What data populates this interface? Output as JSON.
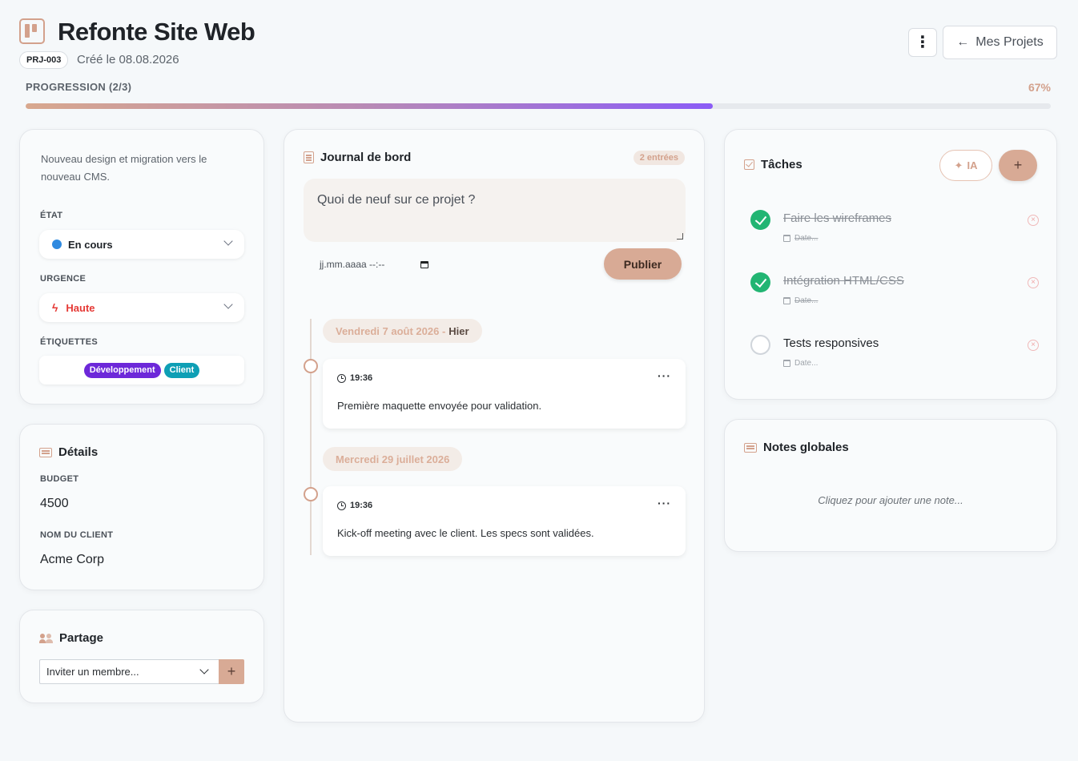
{
  "project": {
    "title": "Refonte Site Web",
    "code": "PRJ-003",
    "created": "Créé le 08.08.2026",
    "back_label": "Mes Projets"
  },
  "progress": {
    "label": "PROGRESSION (2/3)",
    "percent_label": "67%",
    "value": 0.67
  },
  "info": {
    "description": "Nouveau design et migration vers le nouveau CMS.",
    "state_label": "ÉTAT",
    "state_value": "En cours",
    "urgency_label": "URGENCE",
    "urgency_value": "Haute",
    "tags_label": "ÉTIQUETTES",
    "tags": [
      {
        "label": "Développement",
        "color": "#6d28d9"
      },
      {
        "label": "Client",
        "color": "#0e9fb5"
      }
    ]
  },
  "details": {
    "title": "Détails",
    "budget_label": "BUDGET",
    "budget_value": "4500",
    "client_label": "NOM DU CLIENT",
    "client_value": "Acme Corp"
  },
  "share": {
    "title": "Partage",
    "invite_selected": "Inviter un membre..."
  },
  "journal": {
    "title": "Journal de bord",
    "count_badge": "2 entrées",
    "placeholder": "Quoi de neuf sur ce projet ?",
    "date_placeholder": "jj.mm.aaaa --:--",
    "publish_label": "Publier",
    "days": [
      {
        "date": "Vendredi 7 août 2026 -",
        "relative": "Hier",
        "entries": [
          {
            "time": "19:36",
            "text": "Première maquette envoyée pour validation."
          }
        ]
      },
      {
        "date": "Mercredi 29 juillet 2026",
        "relative": "",
        "entries": [
          {
            "time": "19:36",
            "text": "Kick-off meeting avec le client. Les specs sont validées."
          }
        ]
      }
    ]
  },
  "tasks": {
    "title": "Tâches",
    "ia_label": "IA",
    "items": [
      {
        "title": "Faire les wireframes",
        "done": true,
        "date": "Date..."
      },
      {
        "title": "Intégration HTML/CSS",
        "done": true,
        "date": "Date..."
      },
      {
        "title": "Tests responsives",
        "done": false,
        "date": "Date..."
      }
    ]
  },
  "notes": {
    "title": "Notes globales",
    "placeholder": "Cliquez pour ajouter une note..."
  },
  "colors": {
    "accent": "#d3a18c",
    "done_green": "#22b573",
    "state_blue": "#2f8ae0",
    "urgency_red": "#e53935"
  }
}
